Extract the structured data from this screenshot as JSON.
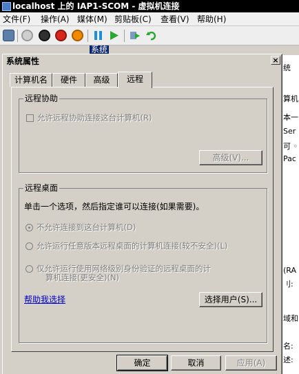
{
  "vm_window": {
    "title": "localhost 上的 IAP1-SCOM - 虚拟机连接",
    "menu": [
      "文件(F)",
      "操作(A)",
      "媒体(M)",
      "剪贴板(C)",
      "查看(V)",
      "帮助(H)"
    ]
  },
  "background": {
    "selected_label": "系统",
    "right_fragments": [
      "统",
      "算机",
      "本一",
      "Ser",
      "可 ◦",
      "Pac",
      "(RA",
      "刂:",
      "域和",
      "名:",
      "述:"
    ]
  },
  "dialog": {
    "title": "系统属性",
    "close_label": "×",
    "tabs": [
      "计算机名",
      "硬件",
      "高级",
      "远程"
    ],
    "active_tab": "远程",
    "remote_assistance": {
      "group_title": "远程协助",
      "checkbox_label": "允许远程协助连接这台计算机(R)",
      "advanced_button": "高级(V)..."
    },
    "remote_desktop": {
      "group_title": "远程桌面",
      "instruction": "单击一个选项，然后指定谁可以连接(如果需要)。",
      "options": [
        "不允许连接到这台计算机(D)",
        "允许运行任意版本远程桌面的计算机连接(较不安全)(L)",
        "仅允许运行使用网络级别身份验证的远程桌面的计",
        "算机连接(更安全)(N)"
      ],
      "help_link": "帮助我选择",
      "select_users_button": "选择用户(S)..."
    },
    "buttons": {
      "ok": "确定",
      "cancel": "取消",
      "apply": "应用(A)"
    }
  }
}
